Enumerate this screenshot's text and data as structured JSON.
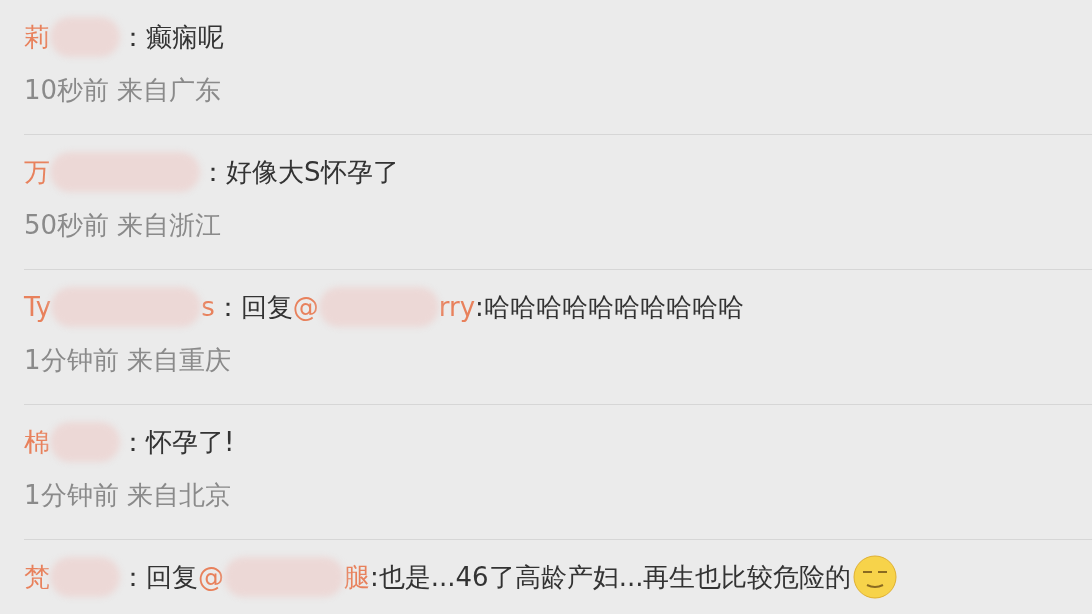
{
  "comments": [
    {
      "line": [
        {
          "kind": "name",
          "text": "莉"
        },
        {
          "kind": "blur-short"
        },
        {
          "kind": "text",
          "text": "：癫痫呢"
        }
      ],
      "meta": "10秒前 来自广东"
    },
    {
      "line": [
        {
          "kind": "name",
          "text": "万"
        },
        {
          "kind": "blur-long"
        },
        {
          "kind": "text",
          "text": "：好像大S怀孕了"
        }
      ],
      "meta": "50秒前 来自浙江"
    },
    {
      "line": [
        {
          "kind": "name",
          "text": "Ty"
        },
        {
          "kind": "blur-long"
        },
        {
          "kind": "name",
          "text": "s"
        },
        {
          "kind": "text",
          "text": "：回复"
        },
        {
          "kind": "name",
          "text": "@"
        },
        {
          "kind": "blur-medium"
        },
        {
          "kind": "name",
          "text": "rry"
        },
        {
          "kind": "text",
          "text": ":哈哈哈哈哈哈哈哈哈哈"
        }
      ],
      "meta": "1分钟前 来自重庆"
    },
    {
      "line": [
        {
          "kind": "name",
          "text": "棉"
        },
        {
          "kind": "blur-short"
        },
        {
          "kind": "text",
          "text": "：怀孕了!"
        }
      ],
      "meta": "1分钟前 来自北京"
    },
    {
      "line": [
        {
          "kind": "name",
          "text": "梵"
        },
        {
          "kind": "blur-short"
        },
        {
          "kind": "text",
          "text": "：回复"
        },
        {
          "kind": "name",
          "text": "@"
        },
        {
          "kind": "blur-medium"
        },
        {
          "kind": "name",
          "text": "腿"
        },
        {
          "kind": "text",
          "text": ":也是...46了高龄产妇...再生也比较危险的"
        },
        {
          "kind": "emoji"
        }
      ]
    }
  ]
}
